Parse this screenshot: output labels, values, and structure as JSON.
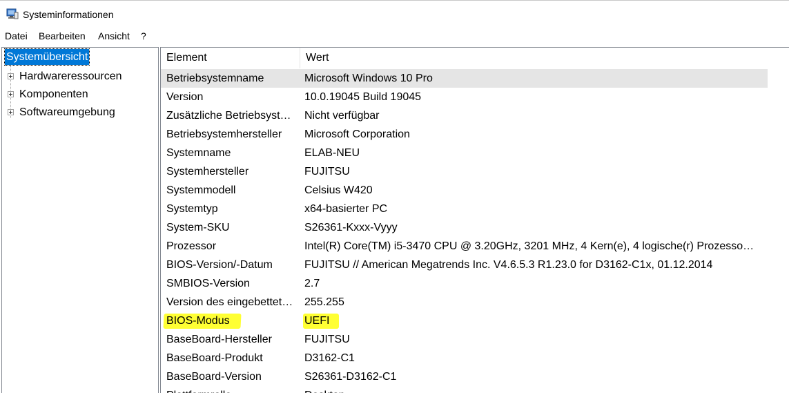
{
  "window": {
    "title": "Systeminformationen",
    "icon": "system-info-icon"
  },
  "menu": [
    "Datei",
    "Bearbeiten",
    "Ansicht",
    "?"
  ],
  "tree": {
    "selected": "Systemübersicht",
    "items": [
      "Hardwareressourcen",
      "Komponenten",
      "Softwareumgebung"
    ]
  },
  "table": {
    "headers": [
      "Element",
      "Wert"
    ],
    "rows": [
      [
        "Betriebsystemname",
        "Microsoft Windows 10 Pro"
      ],
      [
        "Version",
        "10.0.19045 Build 19045"
      ],
      [
        "Zusätzliche Betriebsyst…",
        "Nicht verfügbar"
      ],
      [
        "Betriebsystemhersteller",
        "Microsoft Corporation"
      ],
      [
        "Systemname",
        "ELAB-NEU"
      ],
      [
        "Systemhersteller",
        "FUJITSU"
      ],
      [
        "Systemmodell",
        "Celsius W420"
      ],
      [
        "Systemtyp",
        "x64-basierter PC"
      ],
      [
        "System-SKU",
        "S26361-Kxxx-Vyyy"
      ],
      [
        "Prozessor",
        "Intel(R) Core(TM) i5-3470 CPU @ 3.20GHz, 3201 MHz, 4 Kern(e), 4 logische(r) Prozesso…"
      ],
      [
        "BIOS-Version/-Datum",
        "FUJITSU // American Megatrends Inc. V4.6.5.3 R1.23.0 for D3162-C1x, 01.12.2014"
      ],
      [
        "SMBIOS-Version",
        "2.7"
      ],
      [
        "Version des eingebettet…",
        "255.255"
      ],
      [
        "BIOS-Modus",
        "UEFI"
      ],
      [
        "BaseBoard-Hersteller",
        "FUJITSU"
      ],
      [
        "BaseBoard-Produkt",
        "D3162-C1"
      ],
      [
        "BaseBoard-Version",
        "S26361-D3162-C1"
      ],
      [
        "Plattformrolle",
        "Desktop"
      ]
    ]
  },
  "colors": {
    "selection": "#0078d7",
    "highlight": "#ffff33",
    "row_selected": "#e5e5e5"
  }
}
